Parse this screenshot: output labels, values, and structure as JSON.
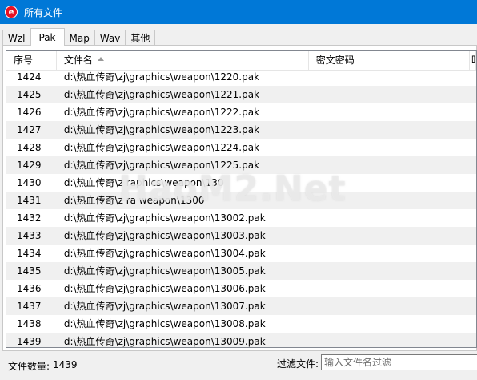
{
  "window": {
    "title": "所有文件",
    "icon": "app-logo-icon"
  },
  "tabs": [
    {
      "label": "Wzl",
      "active": false
    },
    {
      "label": "Pak",
      "active": true
    },
    {
      "label": "Map",
      "active": false
    },
    {
      "label": "Wav",
      "active": false
    },
    {
      "label": "其他",
      "active": false
    }
  ],
  "table": {
    "columns": [
      "序号",
      "文件名",
      "密文密码",
      "時"
    ],
    "sort_indicator": "sort-ascending-icon",
    "rows": [
      {
        "no": "1424",
        "name": "d:\\热血传奇\\zj\\graphics\\weapon\\1220.pak"
      },
      {
        "no": "1425",
        "name": "d:\\热血传奇\\zj\\graphics\\weapon\\1221.pak"
      },
      {
        "no": "1426",
        "name": "d:\\热血传奇\\zj\\graphics\\weapon\\1222.pak"
      },
      {
        "no": "1427",
        "name": "d:\\热血传奇\\zj\\graphics\\weapon\\1223.pak"
      },
      {
        "no": "1428",
        "name": "d:\\热血传奇\\zj\\graphics\\weapon\\1224.pak"
      },
      {
        "no": "1429",
        "name": "d:\\热血传奇\\zj\\graphics\\weapon\\1225.pak"
      },
      {
        "no": "1430",
        "name": "d:\\热血传奇\\z  raphics\\weapon\\130   "
      },
      {
        "no": "1431",
        "name": "d:\\热血传奇\\z  ra    weapon\\1300"
      },
      {
        "no": "1432",
        "name": "d:\\热血传奇\\zj\\graphics\\weapon\\13002.pak"
      },
      {
        "no": "1433",
        "name": "d:\\热血传奇\\zj\\graphics\\weapon\\13003.pak"
      },
      {
        "no": "1434",
        "name": "d:\\热血传奇\\zj\\graphics\\weapon\\13004.pak"
      },
      {
        "no": "1435",
        "name": "d:\\热血传奇\\zj\\graphics\\weapon\\13005.pak"
      },
      {
        "no": "1436",
        "name": "d:\\热血传奇\\zj\\graphics\\weapon\\13006.pak"
      },
      {
        "no": "1437",
        "name": "d:\\热血传奇\\zj\\graphics\\weapon\\13007.pak"
      },
      {
        "no": "1438",
        "name": "d:\\热血传奇\\zj\\graphics\\weapon\\13008.pak"
      },
      {
        "no": "1439",
        "name": "d:\\热血传奇\\zj\\graphics\\weapon\\13009.pak"
      }
    ]
  },
  "watermark": "HaoM2.Net",
  "status": {
    "count_label": "文件数量:",
    "count_value": "1439",
    "filter_label": "过滤文件:",
    "filter_placeholder": "输入文件名过滤",
    "filter_value": ""
  }
}
